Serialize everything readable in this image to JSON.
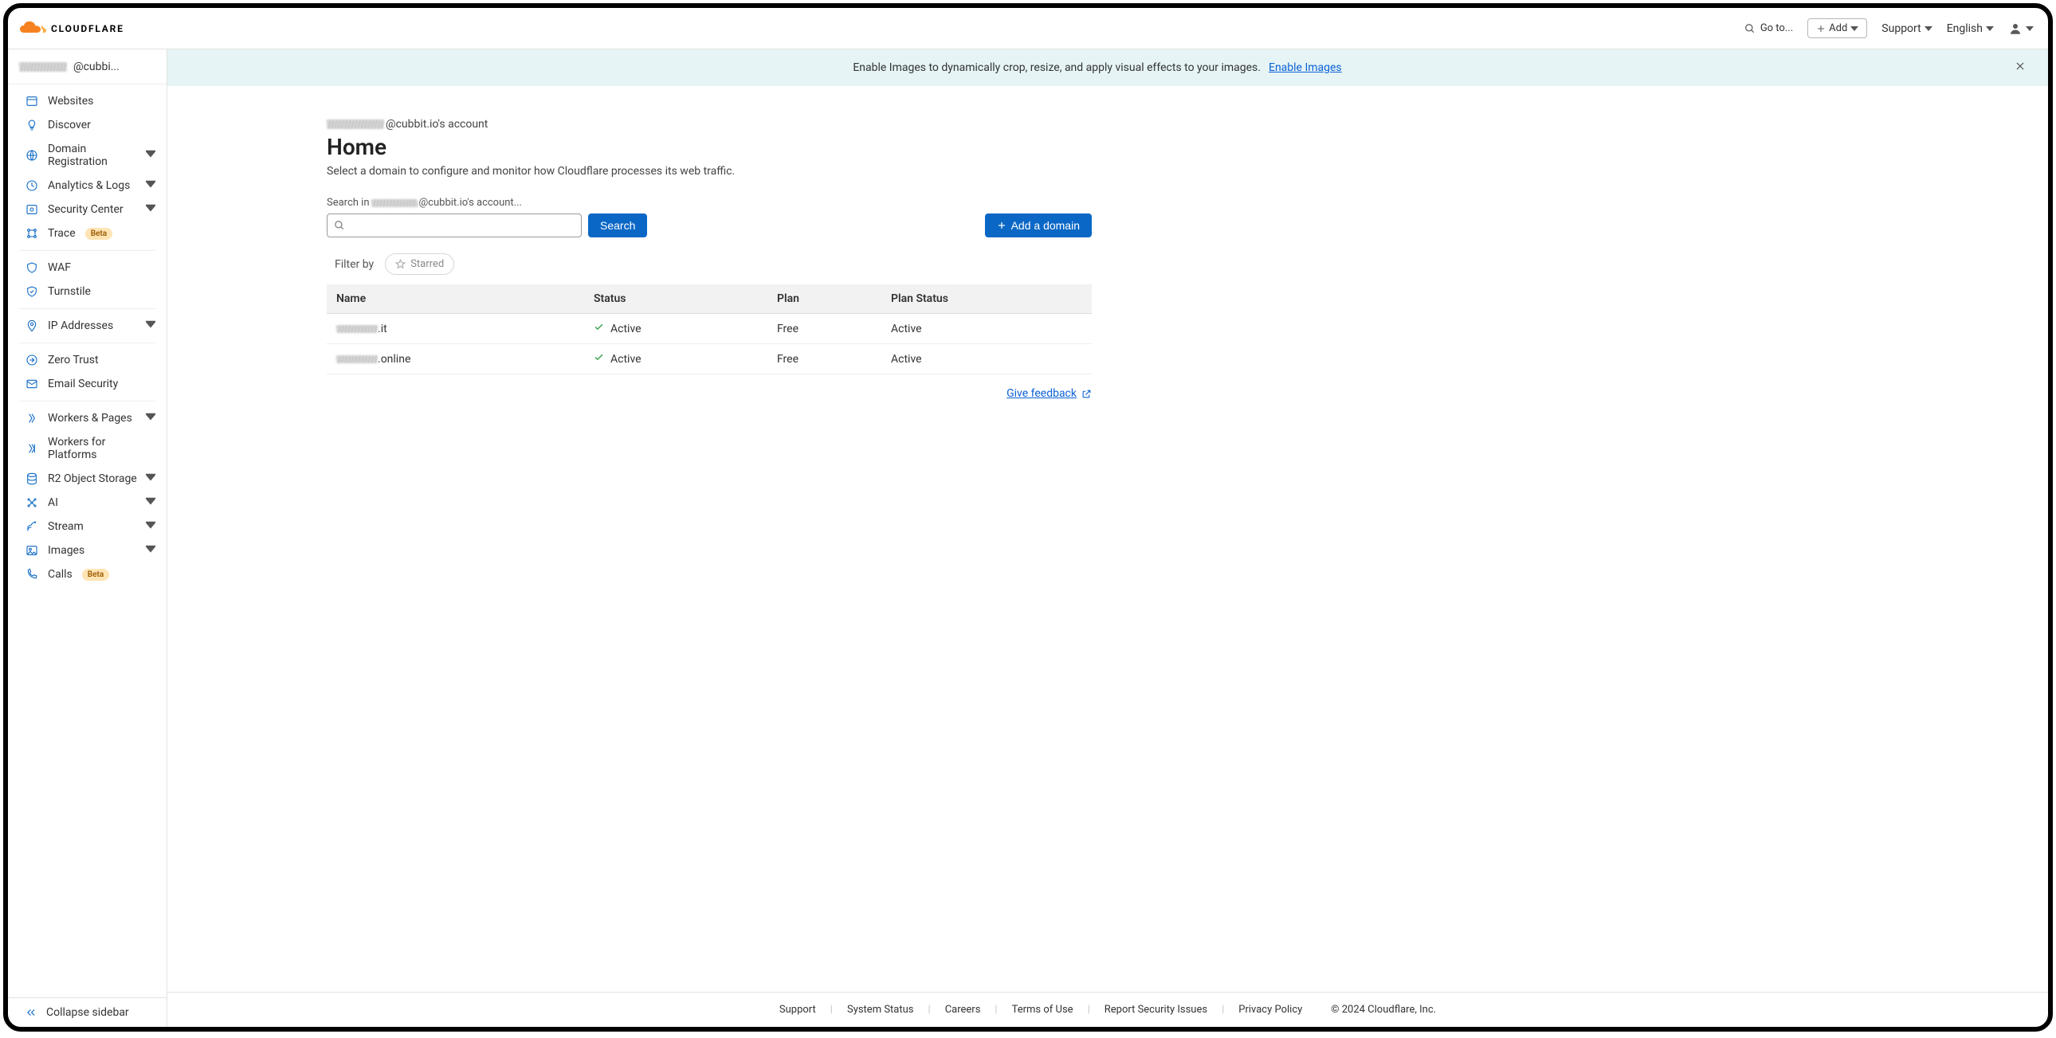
{
  "header": {
    "brand": "CLOUDFLARE",
    "goto": "Go to...",
    "add": "Add",
    "support": "Support",
    "language": "English"
  },
  "banner": {
    "text": "Enable Images to dynamically crop, resize, and apply visual effects to your images.",
    "link": "Enable Images"
  },
  "sidebar": {
    "account_suffix": "@cubbi...",
    "items": [
      {
        "icon": "browser",
        "label": "Websites",
        "expandable": false
      },
      {
        "icon": "bulb",
        "label": "Discover",
        "expandable": false
      },
      {
        "icon": "globe",
        "label": "Domain Registration",
        "expandable": true
      },
      {
        "icon": "analytics",
        "label": "Analytics & Logs",
        "expandable": true
      },
      {
        "icon": "security",
        "label": "Security Center",
        "expandable": true
      },
      {
        "icon": "trace",
        "label": "Trace",
        "badge": "Beta",
        "expandable": false
      }
    ],
    "group2": [
      {
        "icon": "waf",
        "label": "WAF"
      },
      {
        "icon": "turnstile",
        "label": "Turnstile"
      }
    ],
    "group3": [
      {
        "icon": "ip",
        "label": "IP Addresses",
        "expandable": true
      }
    ],
    "group4": [
      {
        "icon": "zerotrust",
        "label": "Zero Trust"
      },
      {
        "icon": "mail",
        "label": "Email Security"
      }
    ],
    "group5": [
      {
        "icon": "workers",
        "label": "Workers & Pages",
        "expandable": true
      },
      {
        "icon": "platforms",
        "label": "Workers for Platforms"
      },
      {
        "icon": "storage",
        "label": "R2 Object Storage",
        "expandable": true
      },
      {
        "icon": "ai",
        "label": "AI",
        "expandable": true
      },
      {
        "icon": "stream",
        "label": "Stream",
        "expandable": true
      },
      {
        "icon": "images",
        "label": "Images",
        "expandable": true
      },
      {
        "icon": "calls",
        "label": "Calls",
        "badge": "Beta"
      }
    ],
    "collapse": "Collapse sidebar"
  },
  "page": {
    "account_suffix": "@cubbit.io's account",
    "title": "Home",
    "subtitle": "Select a domain to configure and monitor how Cloudflare processes its web traffic.",
    "search_label_prefix": "Search in ",
    "search_label_suffix": "@cubbit.io's account...",
    "search_btn": "Search",
    "add_domain_btn": "Add a domain",
    "filter_label": "Filter by",
    "filter_starred": "Starred",
    "feedback": "Give feedback"
  },
  "table": {
    "headers": [
      "Name",
      "Status",
      "Plan",
      "Plan Status"
    ],
    "rows": [
      {
        "name_suffix": ".it",
        "status": "Active",
        "plan": "Free",
        "plan_status": "Active"
      },
      {
        "name_suffix": ".online",
        "status": "Active",
        "plan": "Free",
        "plan_status": "Active"
      }
    ]
  },
  "footer": {
    "links": [
      "Support",
      "System Status",
      "Careers",
      "Terms of Use",
      "Report Security Issues",
      "Privacy Policy"
    ],
    "copyright": "© 2024 Cloudflare, Inc."
  }
}
